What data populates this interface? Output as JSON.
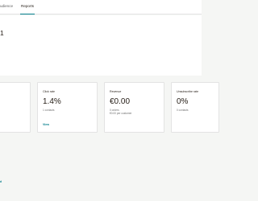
{
  "nav": {
    "tabs": [
      {
        "label": "udience"
      },
      {
        "label": "Reports"
      }
    ]
  },
  "page": {
    "title": "1"
  },
  "cards": [
    {
      "label": "Click rate",
      "value": "1.4%",
      "detail1": "1 contacts",
      "link": "View"
    },
    {
      "label": "Revenue",
      "value": "€0.00",
      "detail1": "0 orders",
      "detail2": "€0.00 per customer"
    },
    {
      "label": "Unsubscribe rate",
      "value": "0%",
      "detail1": "0 contacts"
    }
  ],
  "footer": {
    "link": "d"
  },
  "colors": {
    "accent": "#007c89",
    "text": "#241c15",
    "background": "#f5f6f4"
  }
}
